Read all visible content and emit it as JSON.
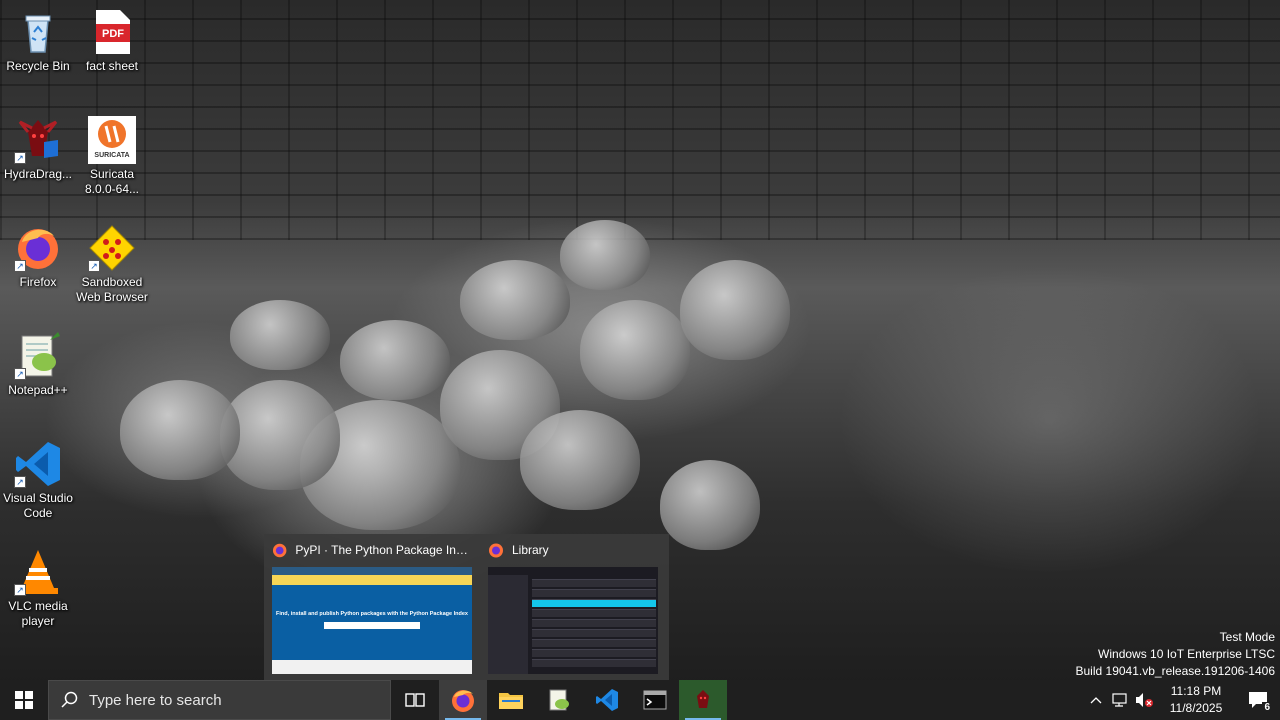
{
  "desktop": {
    "icons": [
      {
        "label": "Recycle Bin",
        "icon": "recycle-bin-icon"
      },
      {
        "label": "fact sheet",
        "icon": "pdf-icon"
      },
      {
        "label": "HydraDrag...",
        "icon": "hydradragon-icon"
      },
      {
        "label": "Suricata 8.0.0-64...",
        "icon": "suricata-icon"
      },
      {
        "label": "Firefox",
        "icon": "firefox-icon"
      },
      {
        "label": "Sandboxed Web Browser",
        "icon": "sandboxie-icon"
      },
      {
        "label": "Notepad++",
        "icon": "notepadpp-icon"
      },
      {
        "label": "Visual Studio Code",
        "icon": "vscode-icon"
      },
      {
        "label": "VLC media player",
        "icon": "vlc-icon"
      }
    ],
    "pdf_badge": "PDF",
    "suricata_badge": "SURICATA"
  },
  "preview": {
    "windows": [
      {
        "title": "PyPI · The Python Package Inde...",
        "icon": "firefox-icon"
      },
      {
        "title": "Library",
        "icon": "firefox-icon"
      }
    ],
    "pypi_hero": "Find, install and publish Python packages with the Python Package Index"
  },
  "taskbar": {
    "search_placeholder": "Type here to search",
    "apps": [
      "task-view",
      "firefox",
      "file-explorer",
      "notepadpp",
      "vscode",
      "terminal",
      "hydradragon"
    ],
    "time": "11:18 PM",
    "date": "11/8/2025",
    "notification_count": "6",
    "accent": "#76b9ed"
  },
  "watermark": {
    "line1": "Test Mode",
    "line2": "Windows 10 IoT Enterprise LTSC",
    "line3": "Build 19041.vb_release.191206-1406"
  }
}
